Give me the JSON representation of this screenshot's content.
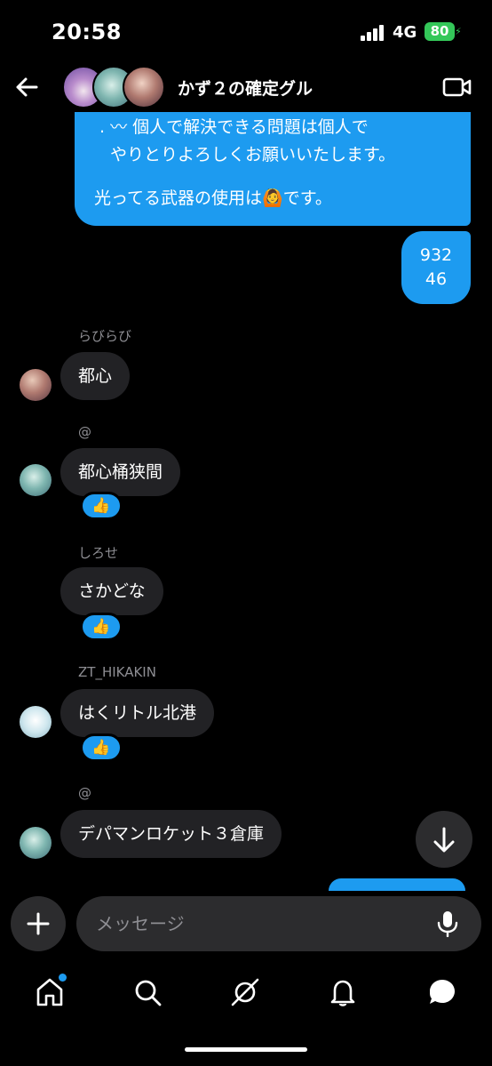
{
  "status_bar": {
    "time": "20:58",
    "network": "4G",
    "battery": "80"
  },
  "header": {
    "group_name": "かず２の確定グル"
  },
  "messages": {
    "own_top": {
      "line1": ". 〰 個人で解決できる問題は個人で",
      "line2": "やりとりよろしくお願いいたします。",
      "line3_pre": "光ってる武器の使用は",
      "line3_emoji": "🙆",
      "line3_post": "です。"
    },
    "own_code": {
      "line1": "932",
      "line2": "46"
    },
    "m1": {
      "sender": "らびらび",
      "text": "都心"
    },
    "m2": {
      "sender": "@",
      "text": "都心桶狭間",
      "reaction": "👍"
    },
    "m3": {
      "sender": "しろせ",
      "text": "さかどな",
      "reaction": "👍"
    },
    "m4": {
      "sender": "ZT_HIKAKIN",
      "text": "はくリトル北港",
      "reaction": "👍"
    },
    "m5": {
      "sender": "@",
      "text": "デパマンロケット３倉庫"
    }
  },
  "composer": {
    "placeholder": "メッセージ"
  },
  "colors": {
    "accent": "#1d9bf0",
    "incoming": "#222225",
    "battery": "#34c759"
  },
  "icons": [
    "back-arrow-icon",
    "video-call-icon",
    "arrow-down-icon",
    "plus-icon",
    "mic-icon",
    "home-icon",
    "search-icon",
    "spaces-icon",
    "bell-icon",
    "messages-icon"
  ]
}
